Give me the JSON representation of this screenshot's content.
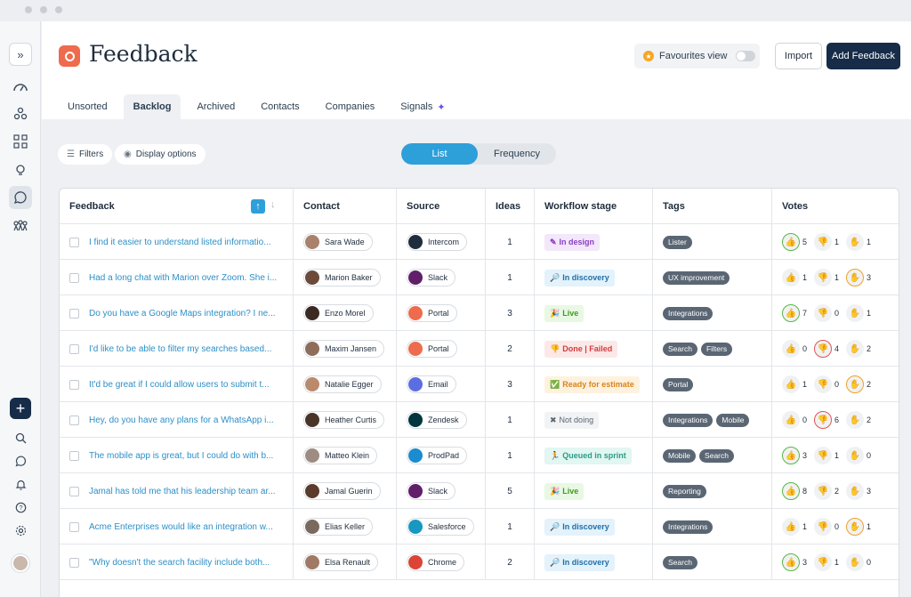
{
  "app": {
    "title": "Feedback",
    "favourites_label": "Favourites view",
    "import_label": "Import",
    "add_label": "Add Feedback"
  },
  "sidebar": {
    "collapse_glyph": "»",
    "icons": [
      "dashboard-icon",
      "modules-icon",
      "grid-icon",
      "bulb-icon",
      "feedback-icon",
      "people-icon"
    ],
    "bottom_icons": [
      "plus-icon",
      "search-icon",
      "chat-icon",
      "bell-icon",
      "help-icon",
      "settings-icon",
      "user-avatar"
    ]
  },
  "tabs": [
    {
      "label": "Unsorted",
      "active": false
    },
    {
      "label": "Backlog",
      "active": true
    },
    {
      "label": "Archived",
      "active": false
    },
    {
      "label": "Contacts",
      "active": false
    },
    {
      "label": "Companies",
      "active": false
    },
    {
      "label": "Signals",
      "active": false
    }
  ],
  "toolbar": {
    "filters_label": "Filters",
    "display_label": "Display options",
    "view_list": "List",
    "view_frequency": "Frequency"
  },
  "table": {
    "headers": {
      "feedback": "Feedback",
      "contact": "Contact",
      "source": "Source",
      "ideas": "Ideas",
      "workflow": "Workflow stage",
      "tags": "Tags",
      "votes": "Votes"
    },
    "rows": [
      {
        "text": "I find it easier to understand listed informatio...",
        "contact": "Sara Wade",
        "source": "Intercom",
        "source_color": "#1f2d3d",
        "ideas": "1",
        "wf": "In design",
        "wf_class": "wf-design",
        "wf_icon": "✎",
        "tags": [
          "Lister"
        ],
        "votes": [
          [
            "5",
            true
          ],
          [
            "1",
            false
          ],
          [
            "1",
            false
          ]
        ]
      },
      {
        "text": "Had a long chat with Marion over Zoom. She i...",
        "contact": "Marion Baker",
        "source": "Slack",
        "source_color": "#611f69",
        "ideas": "1",
        "wf": "In discovery",
        "wf_class": "wf-discovery",
        "wf_icon": "🔎",
        "tags": [
          "UX improvement"
        ],
        "votes": [
          [
            "1",
            false
          ],
          [
            "1",
            false
          ],
          [
            "3",
            true
          ]
        ]
      },
      {
        "text": "Do you have a Google Maps integration? I ne...",
        "contact": "Enzo Morel",
        "source": "Portal",
        "source_color": "#ef6b4d",
        "ideas": "3",
        "wf": "Live",
        "wf_class": "wf-live",
        "wf_icon": "🎉",
        "tags": [
          "Integrations"
        ],
        "votes": [
          [
            "7",
            true
          ],
          [
            "0",
            false
          ],
          [
            "1",
            false
          ]
        ]
      },
      {
        "text": "I'd like to be able to filter my searches based...",
        "contact": "Maxim Jansen",
        "source": "Portal",
        "source_color": "#ef6b4d",
        "ideas": "2",
        "wf": "Done | Failed",
        "wf_class": "wf-failed",
        "wf_icon": "👎",
        "tags": [
          "Search",
          "Filters"
        ],
        "votes": [
          [
            "0",
            false
          ],
          [
            "4",
            true
          ],
          [
            "2",
            false
          ]
        ]
      },
      {
        "text": "It'd be great if I could allow users to submit t...",
        "contact": "Natalie Egger",
        "source": "Email",
        "source_color": "#5b6ee1",
        "ideas": "3",
        "wf": "Ready for estimate",
        "wf_class": "wf-estimate",
        "wf_icon": "✅",
        "tags": [
          "Portal"
        ],
        "votes": [
          [
            "1",
            false
          ],
          [
            "0",
            false
          ],
          [
            "2",
            true
          ]
        ]
      },
      {
        "text": "Hey, do you have any plans for a WhatsApp i...",
        "contact": "Heather Curtis",
        "source": "Zendesk",
        "source_color": "#03363d",
        "ideas": "1",
        "wf": "Not doing",
        "wf_class": "wf-notdoing",
        "wf_icon": "✖",
        "tags": [
          "Integrations",
          "Mobile"
        ],
        "votes": [
          [
            "0",
            false
          ],
          [
            "6",
            true
          ],
          [
            "2",
            false
          ]
        ]
      },
      {
        "text": "The mobile app is great, but I could do with b...",
        "contact": "Matteo Klein",
        "source": "ProdPad",
        "source_color": "#1a8ccf",
        "ideas": "1",
        "wf": "Queued in sprint",
        "wf_class": "wf-sprint",
        "wf_icon": "🏃",
        "tags": [
          "Mobile",
          "Search"
        ],
        "votes": [
          [
            "3",
            true
          ],
          [
            "1",
            false
          ],
          [
            "0",
            false
          ]
        ]
      },
      {
        "text": "Jamal has told me that his leadership team ar...",
        "contact": "Jamal Guerin",
        "source": "Slack",
        "source_color": "#611f69",
        "ideas": "5",
        "wf": "Live",
        "wf_class": "wf-live",
        "wf_icon": "🎉",
        "tags": [
          "Reporting"
        ],
        "votes": [
          [
            "8",
            true
          ],
          [
            "2",
            false
          ],
          [
            "3",
            false
          ]
        ]
      },
      {
        "text": "Acme Enterprises would like an integration w...",
        "contact": "Elias Keller",
        "source": "Salesforce",
        "source_color": "#1798c1",
        "ideas": "1",
        "wf": "In discovery",
        "wf_class": "wf-discovery",
        "wf_icon": "🔎",
        "tags": [
          "Integrations"
        ],
        "votes": [
          [
            "1",
            false
          ],
          [
            "0",
            false
          ],
          [
            "1",
            true
          ]
        ]
      },
      {
        "text": "\"Why doesn't the search facility include both...",
        "contact": "Elsa Renault",
        "source": "Chrome",
        "source_color": "#db4437",
        "ideas": "2",
        "wf": "In discovery",
        "wf_class": "wf-discovery",
        "wf_icon": "🔎",
        "tags": [
          "Search"
        ],
        "votes": [
          [
            "3",
            true
          ],
          [
            "1",
            false
          ],
          [
            "0",
            false
          ]
        ]
      }
    ]
  }
}
